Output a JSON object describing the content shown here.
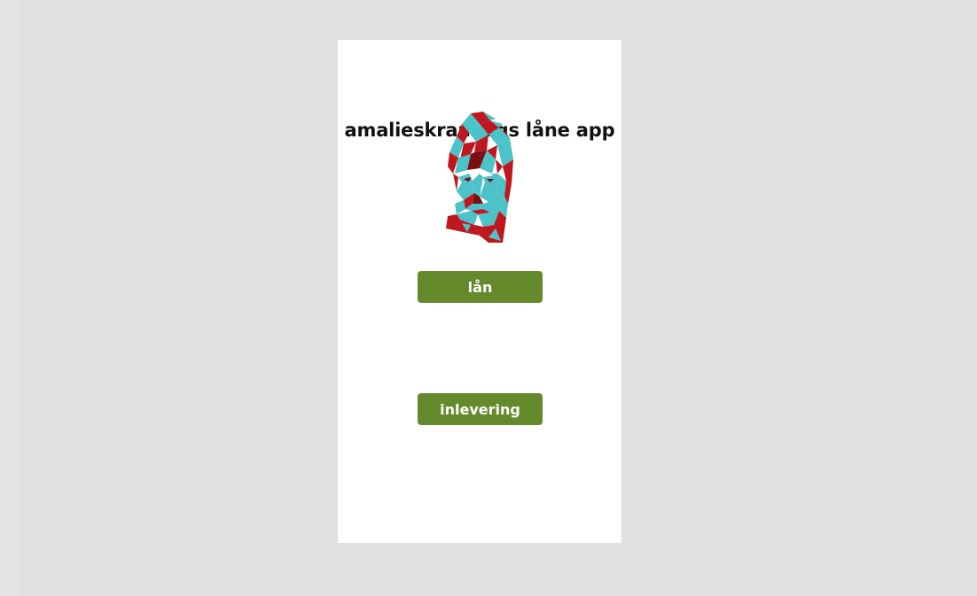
{
  "app": {
    "title": "amalieskram vgs låne app"
  },
  "portrait": {
    "icon": "amalie-skram-portrait-icon",
    "colors": {
      "red": "#c0171f",
      "teal": "#4cc3c9",
      "dark": "#7a0f14"
    }
  },
  "buttons": {
    "laan_label": "lån",
    "inlevering_label": "inlevering",
    "color": "#648a2c"
  },
  "theme": {
    "background": "#e0e0e0",
    "screen": "#ffffff"
  }
}
